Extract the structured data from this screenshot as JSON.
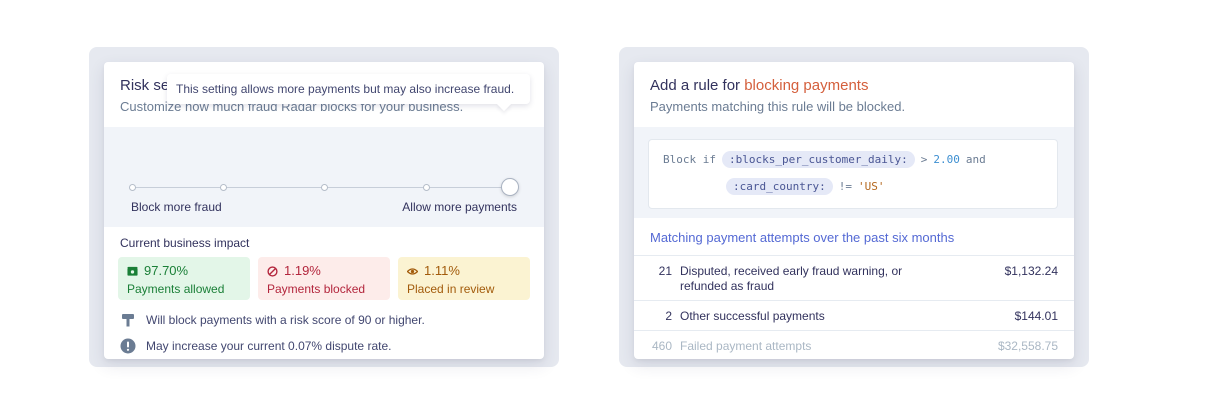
{
  "risk_settings": {
    "title": "Risk settings",
    "subtitle": "Customize how much fraud Radar blocks for your business.",
    "tooltip": "This setting allows more payments but may also increase fraud.",
    "slider": {
      "left_label": "Block more fraud",
      "right_label": "Allow more payments",
      "steps": 5,
      "selected_step": 5
    },
    "impact_title": "Current business impact",
    "stats": [
      {
        "value": "97.70%",
        "label": "Payments allowed",
        "icon": "cash-icon",
        "color": "#1a7f37"
      },
      {
        "value": "1.19%",
        "label": "Payments blocked",
        "icon": "blocked-icon",
        "color": "#b3263d"
      },
      {
        "value": "1.11%",
        "label": "Placed in review",
        "icon": "eye-icon",
        "color": "#a25b0b"
      }
    ],
    "notes": [
      {
        "icon": "gavel-icon",
        "text": "Will block payments with a risk score of 90 or higher."
      },
      {
        "icon": "warning-icon",
        "text": "May increase your current 0.07% dispute rate."
      }
    ]
  },
  "add_rule": {
    "title_prefix": "Add a rule for ",
    "title_accent": "blocking payments",
    "subtitle": "Payments matching this rule will be blocked.",
    "rule": {
      "keyword": "Block if",
      "attr1": ":blocks_per_customer_daily:",
      "op1": ">",
      "val1": "2.00",
      "conj": "and",
      "attr2": ":card_country:",
      "op2": "!=",
      "val2": "'US'"
    },
    "match_title": "Matching payment attempts over the past six months",
    "rows": [
      {
        "count": "21",
        "desc": "Disputed, received early fraud warning, or refunded as fraud",
        "amount": "$1,132.24"
      },
      {
        "count": "2",
        "desc": "Other successful payments",
        "amount": "$144.01"
      },
      {
        "count": "460",
        "desc": "Failed payment attempts",
        "amount": "$32,558.75"
      }
    ]
  },
  "colors": {
    "accent": "#d45f3c",
    "link": "#5469d4"
  }
}
